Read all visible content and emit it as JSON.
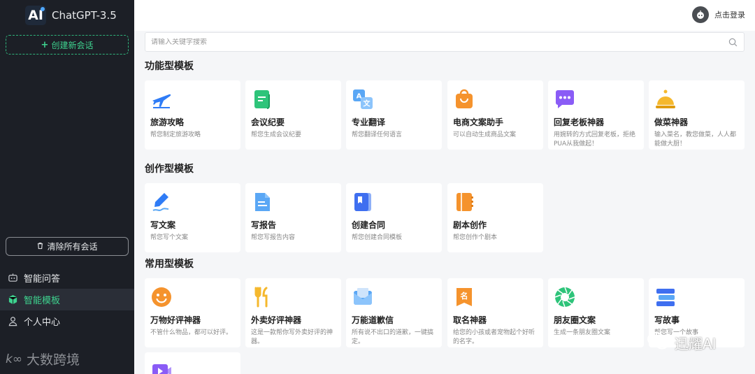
{
  "sidebar": {
    "brand_logo_text": "AI",
    "brand_title": "ChatGPT-3.5",
    "new_chat_label": "创建新会话",
    "clear_label": "清除所有会话",
    "nav": [
      {
        "label": "智能问答",
        "icon": "robot-icon"
      },
      {
        "label": "智能模板",
        "icon": "cube-icon",
        "active": true
      },
      {
        "label": "个人中心",
        "icon": "user-icon"
      }
    ]
  },
  "header": {
    "login_label": "点击登录"
  },
  "search": {
    "placeholder": "请输入关键字搜索"
  },
  "sections": [
    {
      "title": "功能型模板",
      "cards": [
        {
          "title": "旅游攻略",
          "desc": "帮您制定旅游攻略",
          "icon": "airplane-icon",
          "color": "#2f7cf6"
        },
        {
          "title": "会议纪要",
          "desc": "帮您生成会议纪要",
          "icon": "document-icon",
          "color": "#2ec47a"
        },
        {
          "title": "专业翻译",
          "desc": "帮您翻译任何语言",
          "icon": "translate-icon",
          "color": "#5aa7f5"
        },
        {
          "title": "电商文案助手",
          "desc": "可以自动生成商品文案",
          "icon": "shopping-bag-icon",
          "color": "#f5932d"
        },
        {
          "title": "回复老板神器",
          "desc": "用婉转的方式回复老板，拒绝PUA从我做起！",
          "icon": "chat-bubble-icon",
          "color": "#8a5cf6"
        },
        {
          "title": "做菜神器",
          "desc": "输入菜名，教您做菜，人人都能做大厨！",
          "icon": "cloche-icon",
          "color": "#f5b82d"
        }
      ]
    },
    {
      "title": "创作型模板",
      "cards": [
        {
          "title": "写文案",
          "desc": "帮您写个文案",
          "icon": "pen-icon",
          "color": "#2f7cf6"
        },
        {
          "title": "写报告",
          "desc": "帮您写报告内容",
          "icon": "report-icon",
          "color": "#5aa7f5"
        },
        {
          "title": "创建合同",
          "desc": "帮您创建合同模板",
          "icon": "contract-icon",
          "color": "#3f6ff0"
        },
        {
          "title": "剧本创作",
          "desc": "帮您创作个剧本",
          "icon": "notebook-icon",
          "color": "#f5932d"
        }
      ]
    },
    {
      "title": "常用型模板",
      "cards": [
        {
          "title": "万物好评神器",
          "desc": "不管什么物品，都可以好评。",
          "icon": "smile-icon",
          "color": "#f5932d"
        },
        {
          "title": "外卖好评神器",
          "desc": "这是一款帮你写外卖好评的神器。",
          "icon": "fork-knife-icon",
          "color": "#f5b82d"
        },
        {
          "title": "万能道歉信",
          "desc": "所有说不出口的道歉，一键搞定。",
          "icon": "envelope-icon",
          "color": "#5aa7f5"
        },
        {
          "title": "取名神器",
          "desc": "给您的小孩或者宠物起个好听的名字。",
          "icon": "name-tag-icon",
          "color": "#f5932d"
        },
        {
          "title": "朋友圈文案",
          "desc": "生成一条朋友圈文案",
          "icon": "camera-shutter-icon",
          "color": "#2ec47a"
        },
        {
          "title": "写故事",
          "desc": "帮您写一个故事",
          "icon": "books-icon",
          "color": "#3f6ff0"
        },
        {
          "title": "",
          "desc": "",
          "icon": "video-icon",
          "color": "#8a5cf6"
        }
      ]
    }
  ],
  "watermarks": {
    "left": "大数跨境",
    "right": "迅耀AI"
  }
}
